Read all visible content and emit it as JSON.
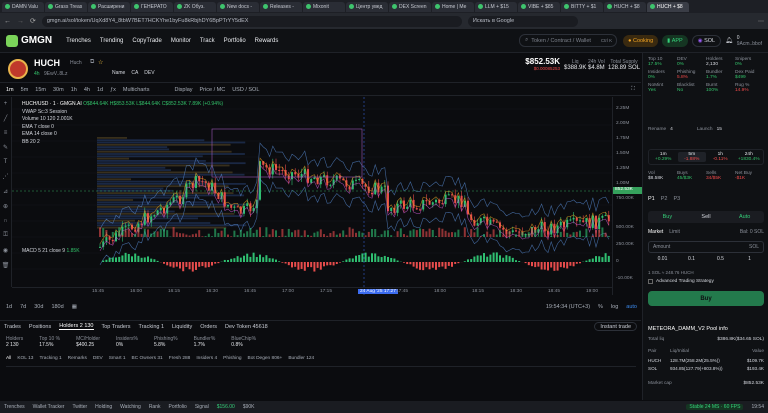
{
  "browser": {
    "tabs": [
      "DAMN Valu",
      "Grass Treas",
      "Расширени",
      "ГЕНЕРАТО",
      "ZK Обуз.",
      "New docs -",
      "Releases -",
      "Mixonit",
      "Центр увед",
      "DEX Screen",
      "Home | Me",
      "LLM + $15",
      "VIBE + $85",
      "BITTY + $1",
      "HUCH + $8",
      "HUCH + $8"
    ],
    "url": "gmgn.ai/sol/token/UqXd8Y4_8tbW7BET7HCKYhe1byFu8kRbjhDY6BpPTrYY5dEX",
    "search_placeholder": "Искать в Google"
  },
  "nav": {
    "logo": "GMGN",
    "links": [
      "Trenches",
      "Trending",
      "CopyTrade",
      "Monitor",
      "Track",
      "Portfolio",
      "Rewards"
    ],
    "search_placeholder": "Token / Contract / Wallet",
    "search_shortcut": "Ctrl K",
    "cooking": "Cooking",
    "app": "APP",
    "chain": "SOL",
    "user": "0",
    "user_sub": "9Acm..bbof"
  },
  "token": {
    "name": "HUCH",
    "sub": "Huch",
    "age": "4h",
    "holders_short": "9EwV..8Lz",
    "price": "$852.53K",
    "price_sub": "$0.00085253",
    "vol24_label": "24h Vol",
    "vol24": "$388.9K",
    "liq_label": "Liq",
    "liq": "$4.8M",
    "supply_label": "Total Supply",
    "supply": "128.89 SOL",
    "tags": [
      "Name",
      "CA",
      "DEV"
    ]
  },
  "chart_toolbar": {
    "items": [
      "1m",
      "5m",
      "15m",
      "30m",
      "1h",
      "4h",
      "1d",
      "Multicharts",
      "Display",
      "Price / MC",
      "USD / SOL"
    ]
  },
  "chart_info": {
    "title": "HUCH/USD · 1 · GMGN.AI",
    "ohlc": "O$844.64K H$853.53K L$844.64K C$852.53K 7.89K (+0.94%)",
    "vwap": "VWAP Sc:3 Session",
    "volume": "Volume 10 120 2.001K",
    "ema7": "EMA 7 close 0",
    "ema14": "EMA 14 close 0",
    "bb": "BB 20 2",
    "macd": "MACD 5 21 close 9",
    "macd_val": "1.85K"
  },
  "price_axis": [
    "2.25M",
    "2.00M",
    "1.75M",
    "1.50M",
    "1.25M",
    "1.00M",
    "750.00K",
    "500.00K",
    "250.00K",
    "0",
    "-10.00K"
  ],
  "price_tag": "852.53K",
  "time_axis": [
    "15:45",
    "16:00",
    "16:15",
    "16:30",
    "16:45",
    "17:00",
    "17:15",
    "24 Aug '25 17:27",
    "17:45",
    "18:00",
    "18:15",
    "18:30",
    "18:45",
    "19:00"
  ],
  "time_range": {
    "ranges": [
      "1d",
      "7d",
      "30d",
      "180d"
    ],
    "clock": "19:54:34 (UTC+3)",
    "scale": "%",
    "log": "log",
    "auto": "auto"
  },
  "bottom": {
    "tabs": [
      "Trades",
      "Positions",
      "Holders 2 130",
      "Top Traders",
      "Tracking 1",
      "Liquidity",
      "Orders",
      "Dev Token 45618"
    ],
    "instant": "Instant trade",
    "stats_labels": [
      "Holders",
      "Top 10 %",
      "MC/Holder",
      "Insiders%",
      "Phishing%",
      "Bundler%",
      "BlueChip%"
    ],
    "stats_values": [
      "2 130",
      "17.5%",
      "$400.25",
      "0%",
      "5.8%",
      "1.7%",
      "0.8%"
    ],
    "filters": [
      "All",
      "KOL 13",
      "Tracking 1",
      "Remarks",
      "DEV",
      "Smart 1",
      "BC Owners 31",
      "Fresh 288",
      "Insiders 4",
      "Phishing",
      "Bot Degen 806+",
      "Bundler 124"
    ]
  },
  "side": {
    "top10_label": "Top 10",
    "top10": "17.5%",
    "dev_label": "DEV",
    "dev": "0%",
    "holders_label": "Holders",
    "holders": "2,130",
    "snipers_label": "Snipers",
    "snipers": "0%",
    "insiders_label": "Insiders",
    "insiders": "0%",
    "phishing_label": "Phishing",
    "phishing": "5.8%",
    "bundler_label": "Bundler",
    "bundler": "1.7%",
    "devpaid_label": "Dex Paid",
    "devpaid": "$499",
    "nomint_label": "NoMint",
    "nomint": "Yes",
    "blacklist_label": "Blacklist",
    "blacklist": "No",
    "burnt_label": "Burnt",
    "burnt": "100%",
    "rug_label": "Rug %",
    "rug": "14.9%",
    "rename": "Rename",
    "rename_v": "4",
    "launch": "Launch",
    "launch_v": "15",
    "tf": [
      "1m",
      "5m",
      "1h",
      "24h"
    ],
    "tf_vals": [
      "+0.29%",
      "-1.88%",
      "-0.11%",
      "+1830.4%"
    ],
    "vol_label": "Vol",
    "vol": "$8.58K",
    "buys_label": "Buys",
    "buys": "45/$3K",
    "sells_label": "Sells",
    "sells": "34/$5K",
    "net_label": "Net Buy",
    "net": "-$1K",
    "presets": [
      "P1",
      "P2",
      "P3"
    ],
    "buy": "Buy",
    "sell": "Sell",
    "auto": "Auto",
    "market": "Market",
    "limit": "Limit",
    "balance": "Bal: 0 SOL",
    "amount": "Amount",
    "sol": "SOL",
    "amounts": [
      "0.01",
      "0.1",
      "0.5",
      "1"
    ],
    "note": "1 SOL ≈ 248.76 HUCH",
    "adv": "Advanced Trading Strategy",
    "buy_btn": "Buy",
    "pool": "METEORA_DAMM_V2 Pool info",
    "totliq_label": "Total liq",
    "totliq": "$386.8K($34.65 SOL)",
    "pair_label": "Pair",
    "liq_col": "Liq/Initial",
    "val_col": "Value",
    "pairs": [
      [
        "HUCH",
        "128.7M(258.2M(25.5%))",
        "$109.7K"
      ],
      [
        "SOL",
        "934.85(127.79(+803.8%))",
        "$193.4K"
      ]
    ],
    "mc_label": "Market cap",
    "mc": "$852.53K"
  },
  "status": {
    "items": [
      "Trenches",
      "Wallet Tracker",
      "Twitter",
      "Holding",
      "Watching",
      "Rank",
      "Portfolio",
      "Signal"
    ],
    "sol_price": "$156.00",
    "pnl": "$90K",
    "stable": "Stable 24 MS · 60 FPS",
    "clock": "19:54"
  }
}
